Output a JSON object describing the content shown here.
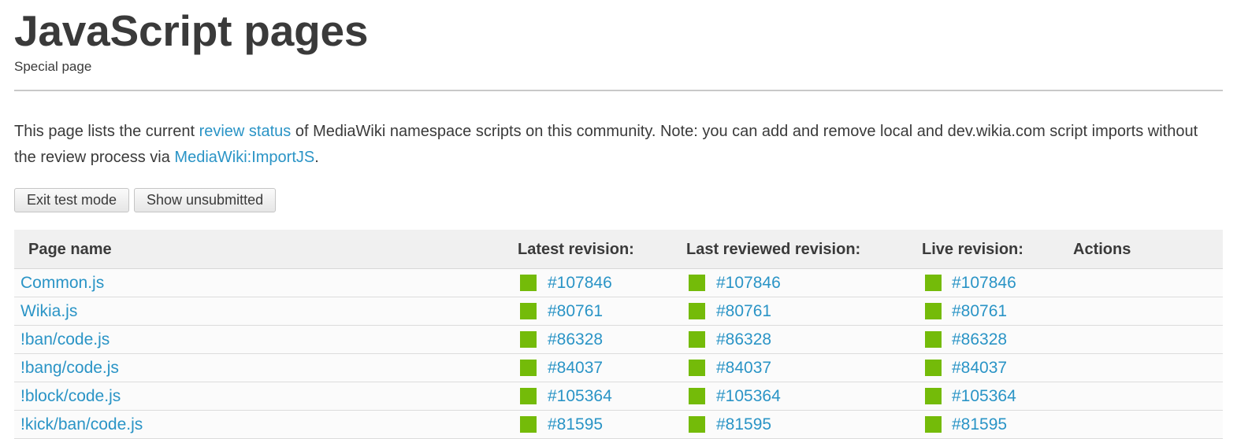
{
  "header": {
    "title": "JavaScript pages",
    "subtitle": "Special page"
  },
  "intro": {
    "text_before": "This page lists the current ",
    "link_review_status": "review status",
    "text_middle": " of MediaWiki namespace scripts on this community. Note: you can add and remove local and dev.wikia.com script imports without the review process via ",
    "link_importjs": "MediaWiki:ImportJS",
    "text_after": "."
  },
  "buttons": {
    "exit_test_mode": "Exit test mode",
    "show_unsubmitted": "Show unsubmitted"
  },
  "table": {
    "headers": {
      "page_name": "Page name",
      "latest": "Latest revision:",
      "last_reviewed": "Last reviewed revision:",
      "live": "Live revision:",
      "actions": "Actions"
    },
    "status_color": "#74bb09",
    "rows": [
      {
        "page": "Common.js",
        "latest": "#107846",
        "reviewed": "#107846",
        "live": "#107846"
      },
      {
        "page": "Wikia.js",
        "latest": "#80761",
        "reviewed": "#80761",
        "live": "#80761"
      },
      {
        "page": "!ban/code.js",
        "latest": "#86328",
        "reviewed": "#86328",
        "live": "#86328"
      },
      {
        "page": "!bang/code.js",
        "latest": "#84037",
        "reviewed": "#84037",
        "live": "#84037"
      },
      {
        "page": "!block/code.js",
        "latest": "#105364",
        "reviewed": "#105364",
        "live": "#105364"
      },
      {
        "page": "!kick/ban/code.js",
        "latest": "#81595",
        "reviewed": "#81595",
        "live": "#81595"
      }
    ]
  }
}
